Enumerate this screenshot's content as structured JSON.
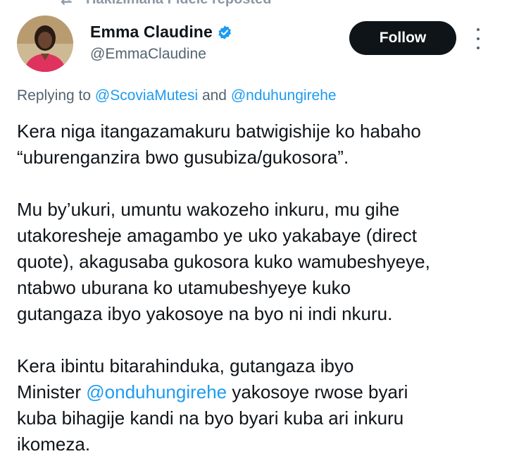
{
  "repost_bar": {
    "text": "Hakizimana Fidele reposted"
  },
  "author": {
    "display_name": "Emma Claudine",
    "handle": "@EmmaClaudine",
    "verified": true
  },
  "follow_label": "Follow",
  "replying": {
    "prefix": "Replying to ",
    "user1": "@ScoviaMutesi",
    "conj": " and ",
    "user2": "@nduhungirehe"
  },
  "tweet": {
    "p1": {
      "line1": "Kera niga itangazamakuru batwigishije ko habaho",
      "line2": "“uburenganzira bwo gusubiza/gukosora”."
    },
    "p2": {
      "line1": "Mu by’ukuri, umuntu wakozeho inkuru, mu gihe",
      "line2": "utakoresheje amagambo ye uko yakabaye (direct",
      "line3": "quote), akagusaba gukosora kuko wamubeshyeye,",
      "line4": "ntabwo uburana ko utamubeshyeye kuko",
      "line5": "gutangaza ibyo yakosoye na byo ni indi nkuru."
    },
    "p3": {
      "line1": "Kera ibintu bitarahinduka, gutangaza ibyo",
      "line2_prefix": "Minister ",
      "mention": "@onduhungirehe",
      "line2_suffix": " yakosoye rwose byari",
      "line3": "kuba bihagije kandi na byo byari kuba ari inkuru",
      "line4": "ikomeza."
    }
  },
  "colors": {
    "link": "#1d9bf0",
    "verified": "#1d9bf0",
    "secondary_text": "#536471",
    "follow_bg": "#0f1419"
  }
}
